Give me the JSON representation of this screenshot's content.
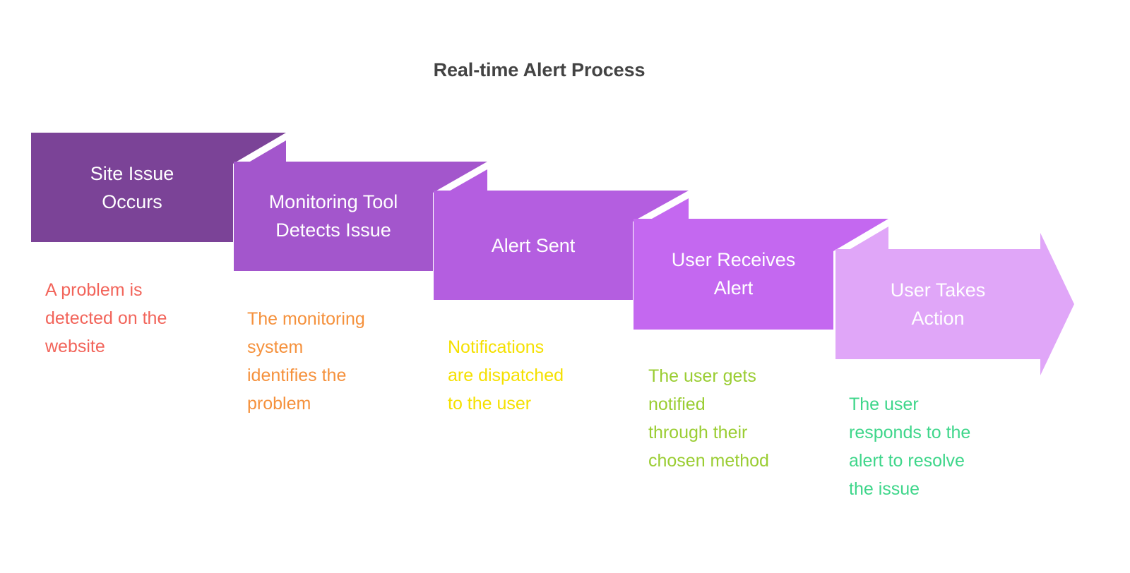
{
  "title": "Real-time Alert Process",
  "title_color": "#434343",
  "background_color": "#ffffff",
  "chart_data": {
    "type": "diagram",
    "diagram_type": "chevron-ribbon-process-flow",
    "title": "Real-time Alert Process",
    "direction": "left-to-right, descending staircase",
    "step_count": 5,
    "legend_position": "none",
    "steps": [
      {
        "index": 1,
        "label": "Site Issue\nOccurs",
        "label_line1": "Site Issue",
        "label_line2": "Occurs",
        "description": "A problem is\ndetected on the\nwebsite",
        "block_color": "#7B4397",
        "description_color": "#F2645A"
      },
      {
        "index": 2,
        "label": "Monitoring Tool\nDetects Issue",
        "label_line1": "Monitoring Tool",
        "label_line2": "Detects Issue",
        "description": "The monitoring\nsystem\nidentifies the\nproblem",
        "block_color": "#A356CC",
        "description_color": "#F5913C"
      },
      {
        "index": 3,
        "label": "Alert Sent",
        "label_line1": "Alert Sent",
        "label_line2": "",
        "description": "Notifications\nare dispatched\nto the user",
        "block_color": "#B45EE0",
        "description_color": "#F5E000"
      },
      {
        "index": 4,
        "label": "User Receives\nAlert",
        "label_line1": "User Receives",
        "label_line2": "Alert",
        "description": "The user gets\nnotified\nthrough their\nchosen method",
        "block_color": "#C468F0",
        "description_color": "#9ACD32"
      },
      {
        "index": 5,
        "label": "User Takes\nAction",
        "label_line1": "User Takes",
        "label_line2": "Action",
        "description": "The user\nresponds to the\nalert to resolve\nthe issue",
        "block_color": "#E0A6F8",
        "description_color": "#3ED68A"
      }
    ]
  }
}
